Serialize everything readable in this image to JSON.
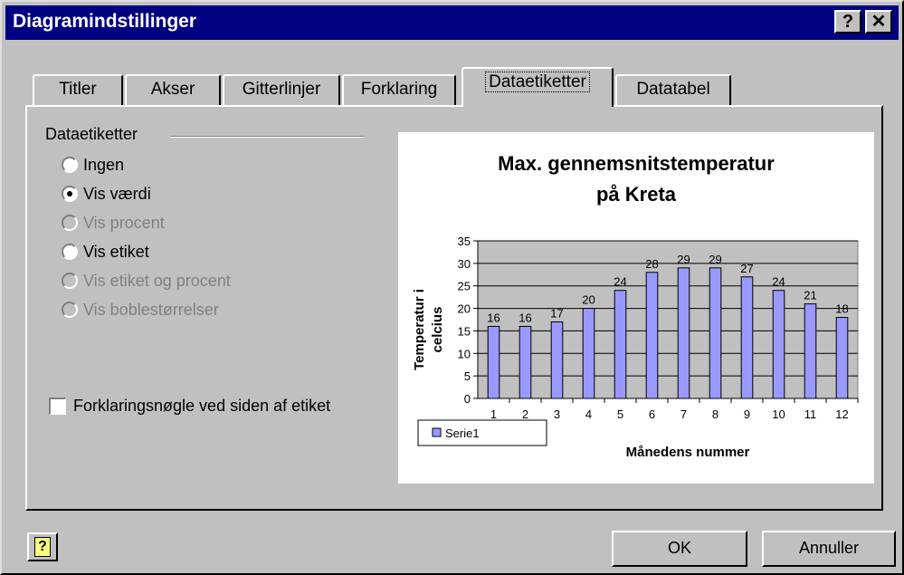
{
  "window": {
    "title": "Diagramindstillinger",
    "help_glyph": "?",
    "close_glyph": "✕"
  },
  "tabs": [
    {
      "label": "Titler"
    },
    {
      "label": "Akser"
    },
    {
      "label": "Gitterlinjer"
    },
    {
      "label": "Forklaring"
    },
    {
      "label": "Dataetiketter",
      "active": true
    },
    {
      "label": "Datatabel"
    }
  ],
  "data_labels": {
    "group_label": "Dataetiketter",
    "options": [
      {
        "label": "Ingen",
        "selected": false,
        "enabled": true
      },
      {
        "label": "Vis værdi",
        "selected": true,
        "enabled": true
      },
      {
        "label": "Vis procent",
        "selected": false,
        "enabled": false
      },
      {
        "label": "Vis etiket",
        "selected": false,
        "enabled": true
      },
      {
        "label": "Vis etiket og procent",
        "selected": false,
        "enabled": false
      },
      {
        "label": "Vis boblestørrelser",
        "selected": false,
        "enabled": false
      }
    ],
    "legend_key_checkbox": {
      "label": "Forklaringsnøgle ved siden af etiket",
      "checked": false
    }
  },
  "buttons": {
    "ok": "OK",
    "cancel": "Annuller",
    "help_icon_glyph": "?"
  },
  "chart_data": {
    "type": "bar",
    "title": "Max. gennemsnitstemperatur på Kreta",
    "title_lines": [
      "Max. gennemsnitstemperatur",
      "på Kreta"
    ],
    "xlabel": "Månedens nummer",
    "ylabel": "Temperatur i celcius",
    "ylabel_lines": [
      "Temperatur i",
      "celcius"
    ],
    "categories": [
      "1",
      "2",
      "3",
      "4",
      "5",
      "6",
      "7",
      "8",
      "9",
      "10",
      "11",
      "12"
    ],
    "series": [
      {
        "name": "Serie1",
        "values": [
          16,
          16,
          17,
          20,
          24,
          28,
          29,
          29,
          27,
          24,
          21,
          18
        ],
        "color": "#9999ff"
      }
    ],
    "ylim": [
      0,
      35
    ],
    "yticks": [
      0,
      5,
      10,
      15,
      20,
      25,
      30,
      35
    ],
    "grid": true,
    "plot_background": "#c0c0c0",
    "data_labels_shown": true,
    "legend_position": "bottom-left"
  }
}
